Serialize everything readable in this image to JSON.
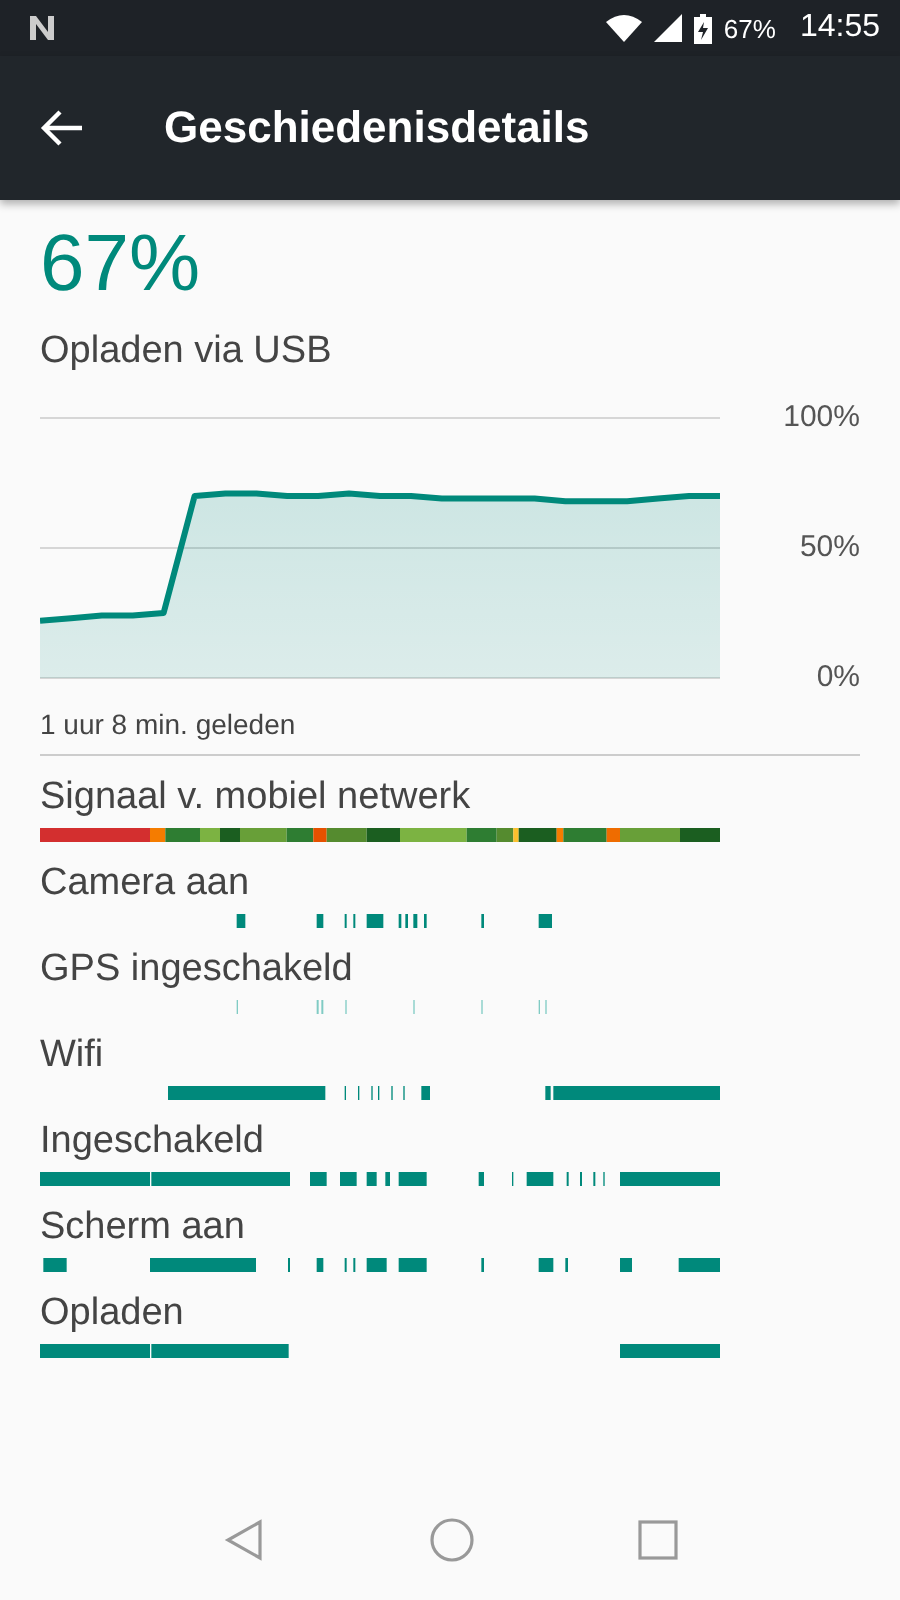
{
  "status_bar": {
    "battery": "67%",
    "time": "14:55"
  },
  "toolbar": {
    "title": "Geschiedenisdetails"
  },
  "summary": {
    "percentage": "67%",
    "status": "Opladen via USB"
  },
  "chart_data": {
    "type": "area",
    "series": [
      {
        "color": "#00897b",
        "values": [
          22,
          23,
          24,
          24,
          25,
          70,
          71,
          71,
          70,
          70,
          71,
          70,
          70,
          69,
          69,
          69,
          69,
          68,
          68,
          68,
          69,
          70,
          70
        ]
      }
    ],
    "ylim": [
      0,
      100
    ],
    "yticks": [
      {
        "value": 100,
        "label": "100%"
      },
      {
        "value": 50,
        "label": "50%"
      },
      {
        "value": 0,
        "label": "0%"
      }
    ]
  },
  "time_label": "1 uur 8 min. geleden",
  "tracks": [
    {
      "label": "Signaal v. mobiel netwerk",
      "kind": "signal"
    },
    {
      "label": "Camera aan",
      "kind": "activity"
    },
    {
      "label": "GPS ingeschakeld",
      "kind": "faint"
    },
    {
      "label": "Wifi",
      "kind": "activity"
    },
    {
      "label": "Ingeschakeld",
      "kind": "activity"
    },
    {
      "label": "Scherm aan",
      "kind": "activity"
    },
    {
      "label": "Opladen",
      "kind": "activity"
    }
  ]
}
